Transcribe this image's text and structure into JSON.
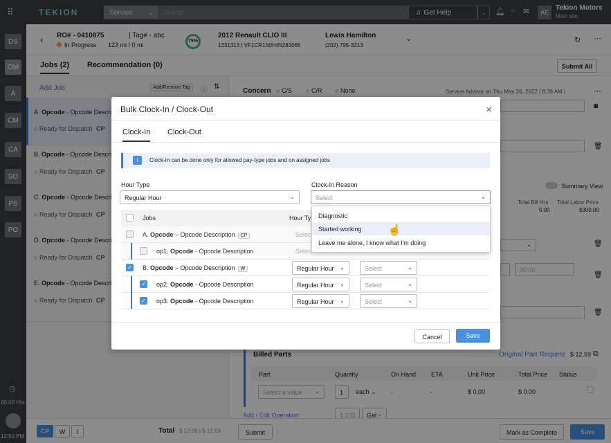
{
  "topbar": {
    "logo": "TEKION",
    "service_label": "Service",
    "search_placeholder": "Search",
    "get_help": "Get Help",
    "avatar": "AE",
    "dealer_name": "Tekion Motors",
    "dealer_site": "Main site"
  },
  "rail": {
    "items": [
      "DS",
      "OM",
      "A",
      "CM",
      "CA",
      "SO",
      "PS",
      "PO"
    ],
    "timer": "00.00 Hrs",
    "time": "12:50 PM"
  },
  "header": {
    "ro": "RO# - 0410875",
    "tag": "| Tag# - abc",
    "status": "In Progress",
    "mileage": "123 mi / 0 mi",
    "progress": "75%",
    "vehicle": "2012 Renault CLIO III",
    "vin": "1231313 | VF1CR1S0H45281066",
    "customer": "Lewis Hamilton",
    "phone": "(202) 795-3213"
  },
  "tabs": {
    "jobs": "Jobs (2)",
    "recommendation": "Recommendation (0)",
    "submit_all": "Submit All"
  },
  "left": {
    "add_job": "Add Job",
    "add_remove_tag": "Add/Remove Tag",
    "cards": [
      {
        "title_prefix": "A.",
        "title_op": "Opcode",
        "title_rest": "- Opcode Descrip",
        "status": "Ready for Dispatch",
        "tag": "CP"
      },
      {
        "title_prefix": "B.",
        "title_op": "Opcode",
        "title_rest": "- Opcode Descrip",
        "status": "Ready for Dispatch",
        "tag": "CP"
      },
      {
        "title_prefix": "C.",
        "title_op": "Opcode",
        "title_rest": "- Opcode Descrip",
        "status": "Ready for Dispatch",
        "tag": "CP"
      },
      {
        "title_prefix": "D.",
        "title_op": "Opcode",
        "title_rest": "- Opcode Descrip",
        "status": "Ready for Dispatch",
        "tag": "CP"
      },
      {
        "title_prefix": "E.",
        "title_op": "Opcode",
        "title_rest": "- Opcode Descript",
        "status": "Ready for Dispatch",
        "tag": "CP"
      }
    ]
  },
  "right": {
    "concern": "Concern",
    "cs": "C/S",
    "cr": "C/R",
    "none": "None",
    "advisor": "Service Advisor on Thu May 26, 2022 | 8:39 AM |",
    "summary_view": "Summary View",
    "total_bill_hrs": "Total Bill Hrs",
    "total_bill_val": "0.00",
    "total_labor": "Total Labor Price",
    "total_labor_val": "$300.00",
    "time_ph": "00:00",
    "billed_parts": "Billed Parts",
    "orig_part_req": "Original Part Request",
    "orig_amount": "$ 12.69",
    "cols": [
      "Part",
      "Quantity",
      "On Hand",
      "ETA",
      "Unit Price",
      "Total Price",
      "Status"
    ],
    "part_ph": "Select a value",
    "qty": "1",
    "unit": "each",
    "onhand": "-",
    "eta": "-",
    "unit_price": "$ 0.00",
    "total_price": "$ 0.00",
    "add_edit": "Add / Edit Operation",
    "qty2": "1.232",
    "unit2": "Gal"
  },
  "bottom": {
    "cp": "CP",
    "w": "W",
    "i": "I",
    "total_label": "Total",
    "total_val": "$ 12.69 | $ 12.69",
    "submit": "Submit",
    "mark_complete": "Mark as Complete",
    "save": "Save"
  },
  "modal": {
    "title": "Bulk Clock-In / Clock-Out",
    "tab_in": "Clock-In",
    "tab_out": "Clock-Out",
    "info": "Clock-In can be done only for allowed pay-type jobs and on assigned jobs",
    "hour_type_label": "Hour Type",
    "hour_type_value": "Regular Hour",
    "reason_label": "Clock-In Reason",
    "reason_placeholder": "Select",
    "col_jobs": "Jobs",
    "col_hour": "Hour Ty",
    "rows": [
      {
        "prefix": "A.",
        "op": "Opcode",
        "desc": "– Opcode Description",
        "tag": "CP",
        "hour": "Selec",
        "reason": ""
      },
      {
        "prefix": "op1.",
        "op": "Opcode",
        "desc": "- Opcode Description",
        "tag": "",
        "hour": "Select",
        "reason": "Select"
      },
      {
        "prefix": "B.",
        "op": "Opcode",
        "desc": "– Opcode Description",
        "tag": "W",
        "hour": "Regular Hour",
        "reason": "Select"
      },
      {
        "prefix": "op2.",
        "op": "Opcode",
        "desc": "- Opcode Description",
        "tag": "",
        "hour": "Regular Hour",
        "reason": "Select"
      },
      {
        "prefix": "op3.",
        "op": "Opcode",
        "desc": "- Opcode Description",
        "tag": "",
        "hour": "Regular Hour",
        "reason": "Select"
      }
    ],
    "dropdown": [
      "Diagnostic",
      "Started working",
      "Leave me alone, I know what I'm doing"
    ],
    "cancel": "Cancel",
    "save": "Save"
  }
}
